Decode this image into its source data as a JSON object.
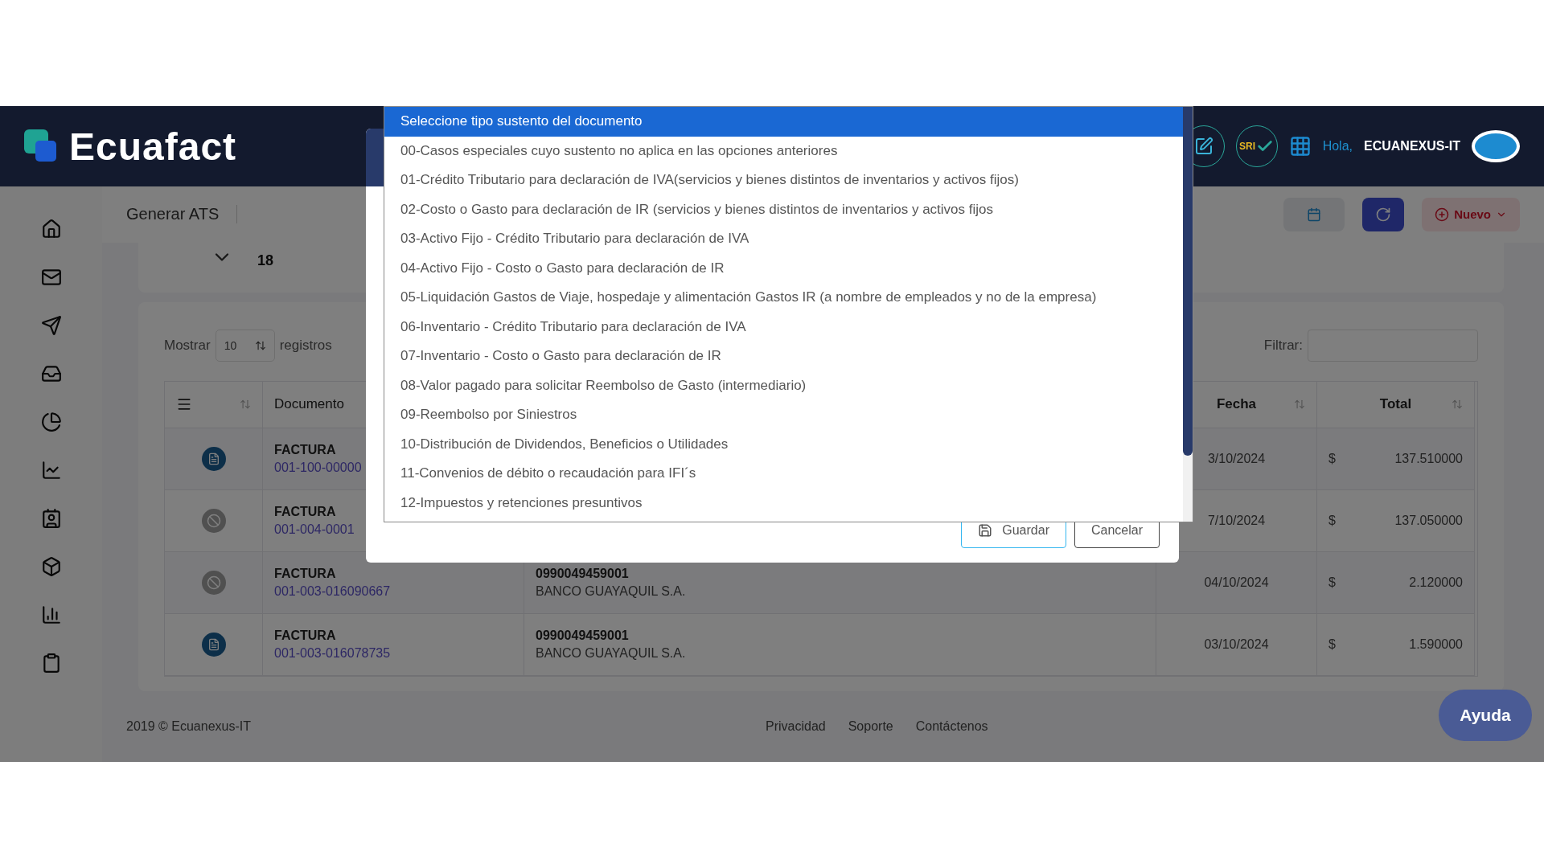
{
  "header": {
    "logo": "Ecuafact",
    "sri_badge": "SRI",
    "greeting": "Hola,",
    "user": "ECUANEXUS-IT"
  },
  "toolbar": {
    "title": "Generar ATS",
    "new_button": "Nuevo"
  },
  "summary": {
    "value": "18"
  },
  "table_controls": {
    "show_label": "Mostrar",
    "page_size": "10",
    "records_label": "registros",
    "filter_label": "Filtrar:"
  },
  "table": {
    "columns": [
      {
        "label": "Documento"
      },
      {
        "label": "Fecha"
      },
      {
        "label": "Total"
      }
    ],
    "rows": [
      {
        "kind": "doc",
        "doc_type": "FACTURA",
        "doc_number": "001-100-00000",
        "date": "3/10/2024",
        "currency": "$",
        "total": "137.510000"
      },
      {
        "kind": "void",
        "doc_type": "FACTURA",
        "doc_number": "001-004-0001",
        "date": "7/10/2024",
        "currency": "$",
        "total": "137.050000"
      },
      {
        "kind": "void",
        "doc_type": "FACTURA",
        "doc_number": "001-003-016090667",
        "issuer_id": "0990049459001",
        "issuer_name": "BANCO GUAYAQUIL S.A.",
        "date": "04/10/2024",
        "currency": "$",
        "total": "2.120000"
      },
      {
        "kind": "doc",
        "doc_type": "FACTURA",
        "doc_number": "001-003-016078735",
        "issuer_id": "0990049459001",
        "issuer_name": "BANCO GUAYAQUIL S.A.",
        "date": "03/10/2024",
        "currency": "$",
        "total": "1.590000"
      }
    ]
  },
  "modal": {
    "dropdown": {
      "options": [
        {
          "label": "Seleccione tipo sustento del documento",
          "selected": true
        },
        {
          "label": "00-Casos especiales cuyo sustento no aplica en las opciones anteriores",
          "selected": false
        },
        {
          "label": "01-Crédito Tributario para declaración de IVA(servicios y bienes distintos de inventarios y activos fijos)",
          "selected": false
        },
        {
          "label": "02-Costo o Gasto para declaración de IR (servicios y bienes distintos de inventarios y activos fijos",
          "selected": false
        },
        {
          "label": "03-Activo Fijo - Crédito Tributario para declaración de IVA",
          "selected": false
        },
        {
          "label": "04-Activo Fijo - Costo o Gasto para declaración de IR",
          "selected": false
        },
        {
          "label": "05-Liquidación Gastos de Viaje, hospedaje y alimentación Gastos IR (a nombre de empleados y no de la empresa)",
          "selected": false
        },
        {
          "label": "06-Inventario - Crédito Tributario para declaración de IVA",
          "selected": false
        },
        {
          "label": "07-Inventario - Costo o Gasto para declaración de IR",
          "selected": false
        },
        {
          "label": "08-Valor pagado para solicitar Reembolso de Gasto (intermediario)",
          "selected": false
        },
        {
          "label": "09-Reembolso por Siniestros",
          "selected": false
        },
        {
          "label": "10-Distribución de Dividendos, Beneficios o Utilidades",
          "selected": false
        },
        {
          "label": "11-Convenios de débito o recaudación para IFI´s",
          "selected": false
        },
        {
          "label": "12-Impuestos y retenciones presuntivos",
          "selected": false
        }
      ]
    },
    "buttons": [
      {
        "label": "Guardar",
        "kind": "save"
      },
      {
        "label": "Cancelar",
        "kind": "cancel"
      }
    ]
  },
  "footer": {
    "copyright": "2019 © Ecuanexus-IT",
    "links": [
      "Privacidad",
      "Soporte",
      "Contáctenos"
    ]
  },
  "help_button": "Ayuda"
}
